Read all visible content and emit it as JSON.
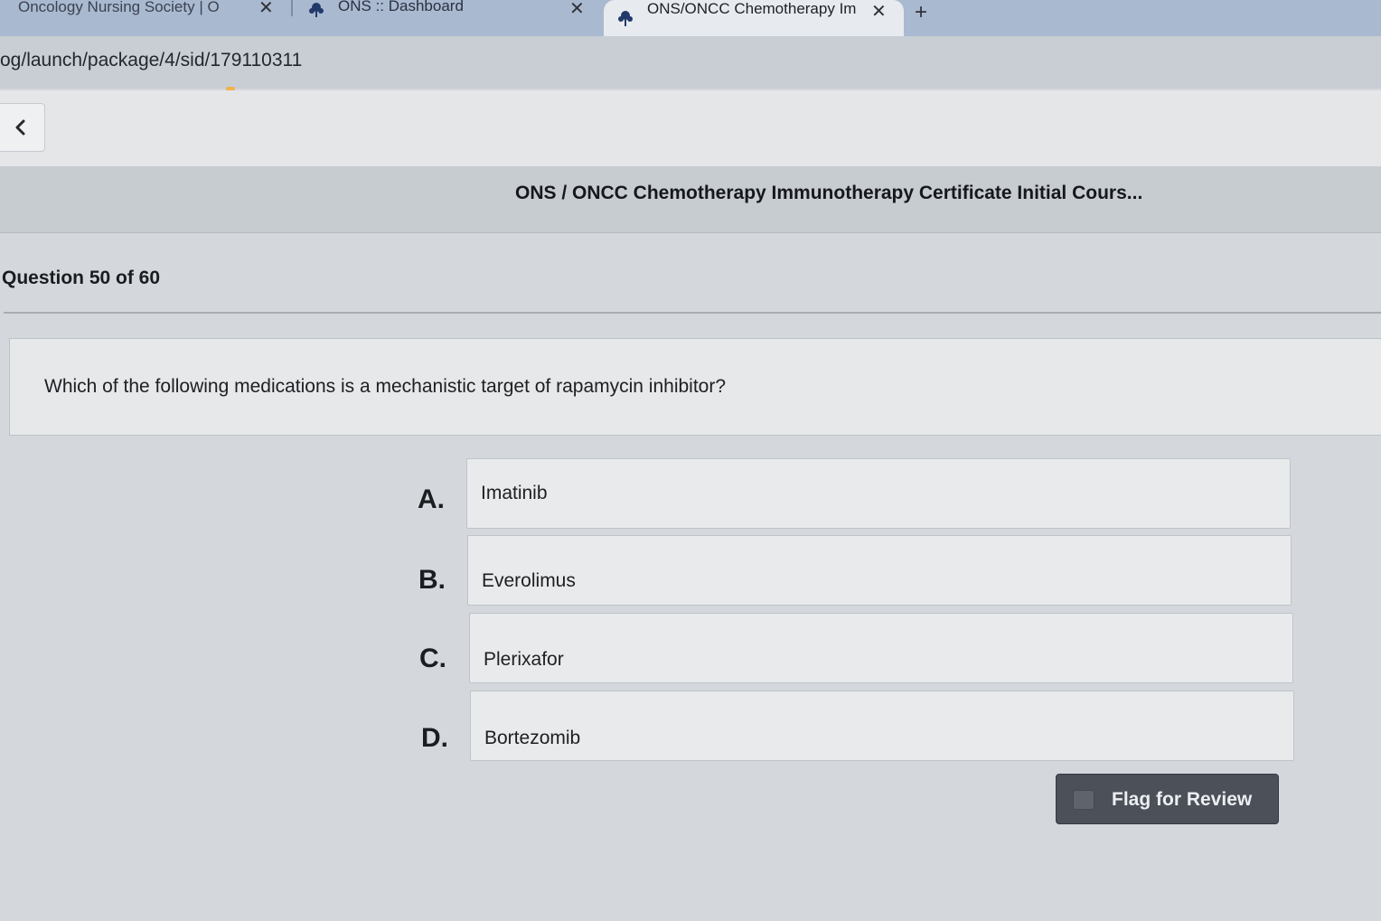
{
  "browser": {
    "tabs": [
      {
        "label": "Oncology Nursing Society | O",
        "close": "✕"
      },
      {
        "label": "ONS :: Dashboard",
        "close": "✕"
      },
      {
        "label": "ONS/ONCC Chemotherapy Im",
        "close": "✕"
      }
    ],
    "new_tab": "+",
    "url": "og/launch/package/4/sid/179110311"
  },
  "toolbar": {
    "back_icon": "chevron-left-icon"
  },
  "course": {
    "title": "ONS / ONCC Chemotherapy Immunotherapy Certificate Initial Cours..."
  },
  "quiz": {
    "counter": "Question 50 of 60",
    "question": "Which of the following medications is a mechanistic target of rapamycin inhibitor?",
    "options": [
      {
        "letter": "A.",
        "text": "Imatinib"
      },
      {
        "letter": "B.",
        "text": "Everolimus"
      },
      {
        "letter": "C.",
        "text": "Plerixafor"
      },
      {
        "letter": "D.",
        "text": "Bortezomib"
      }
    ],
    "flag_label": "Flag for Review"
  },
  "colors": {
    "tabstrip": "#a9b9d0",
    "active_tab": "#e7eaee",
    "flag_button": "#4b5059",
    "page_background": "#d4d8dc"
  }
}
